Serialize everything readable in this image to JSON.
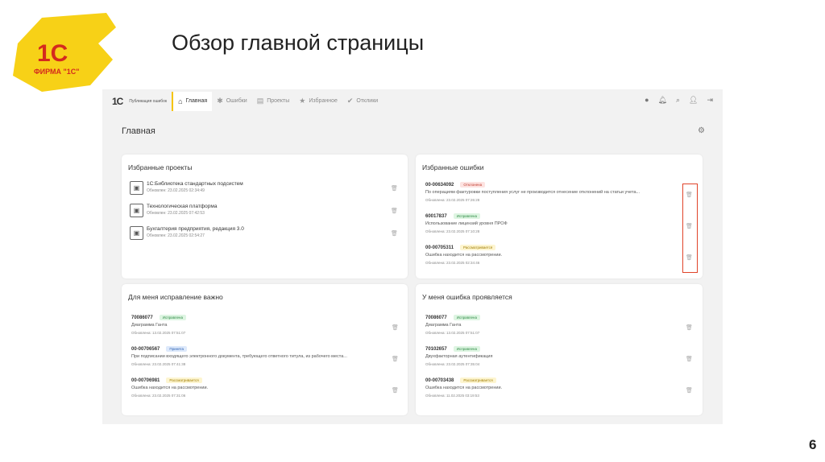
{
  "slide": {
    "title": "Обзор главной страницы",
    "page_number": "6",
    "logo_text": "1С",
    "logo_sub": "ФИРМА \"1С\""
  },
  "nav": {
    "brand": "1С",
    "brand_sub": "Публикация ошибок",
    "tabs": [
      {
        "label": "Главная",
        "icon": "home-icon"
      },
      {
        "label": "Ошибки",
        "icon": "bug-icon"
      },
      {
        "label": "Проекты",
        "icon": "projects-icon"
      },
      {
        "label": "Избранное",
        "icon": "star-icon"
      },
      {
        "label": "Отклики",
        "icon": "check-circle-icon"
      }
    ]
  },
  "page": {
    "title": "Главная"
  },
  "fav_projects": {
    "title": "Избранные проекты",
    "items": [
      {
        "name": "1С:Библиотека стандартных подсистем",
        "updated": "Обновлен: 23.02.2025 02:34:49"
      },
      {
        "name": "Технологическая платформа",
        "updated": "Обновлен: 23.02.2025 07:42:53"
      },
      {
        "name": "Бухгалтерия предприятия, редакция 3.0",
        "updated": "Обновлен: 23.02.2025 02:54:27"
      }
    ]
  },
  "fav_errors": {
    "title": "Избранные ошибки",
    "items": [
      {
        "id": "00-00634092",
        "status": "Отклонена",
        "desc": "По операциям фактуровки поступления услуг не производится отнесение отклонений на статьи учета...",
        "updated": "Обновлена: 23.02.2025 07:26:28"
      },
      {
        "id": "60017837",
        "status": "Исправлена",
        "desc": "Использование лицензий уровня ПРОФ",
        "updated": "Обновлена: 23.02.2025 07:10:28"
      },
      {
        "id": "00-00705311",
        "status": "Рассматривается",
        "desc": "Ошибка находится на рассмотрении.",
        "updated": "Обновлена: 23.02.2025 02:34:46"
      }
    ]
  },
  "important": {
    "title": "Для меня исправление важно",
    "items": [
      {
        "id": "70086077",
        "status": "Исправлена",
        "desc": "Диаграмма Ганта",
        "updated": "Обновлена: 13.02.2025 07:51:07"
      },
      {
        "id": "00-00706567",
        "status": "Принята",
        "desc": "При подписании входящего электронного документа, требующего ответного титула, из рабочего места...",
        "updated": "Обновлена: 23.02.2025 07:41:38"
      },
      {
        "id": "00-00706981",
        "status": "Рассматривается",
        "desc": "Ошибка находится на рассмотрении.",
        "updated": "Обновлена: 23.02.2025 07:31:06"
      }
    ]
  },
  "reproduces": {
    "title": "У меня ошибка проявляется",
    "items": [
      {
        "id": "70086077",
        "status": "Исправлена",
        "desc": "Диаграмма Ганта",
        "updated": "Обновлена: 13.02.2025 07:51:07"
      },
      {
        "id": "70102657",
        "status": "Исправлена",
        "desc": "Двухфакторная аутентификация",
        "updated": "Обновлена: 23.02.2025 07:35:04"
      },
      {
        "id": "00-00703438",
        "status": "Рассматривается",
        "desc": "Ошибка находится на рассмотрении.",
        "updated": "Обновлена: 11.02.2025 03:19:53"
      }
    ]
  },
  "status_colors": {
    "Отклонена": "b-red",
    "Исправлена": "b-green",
    "Принята": "b-blue",
    "Рассматривается": "b-yellow"
  }
}
